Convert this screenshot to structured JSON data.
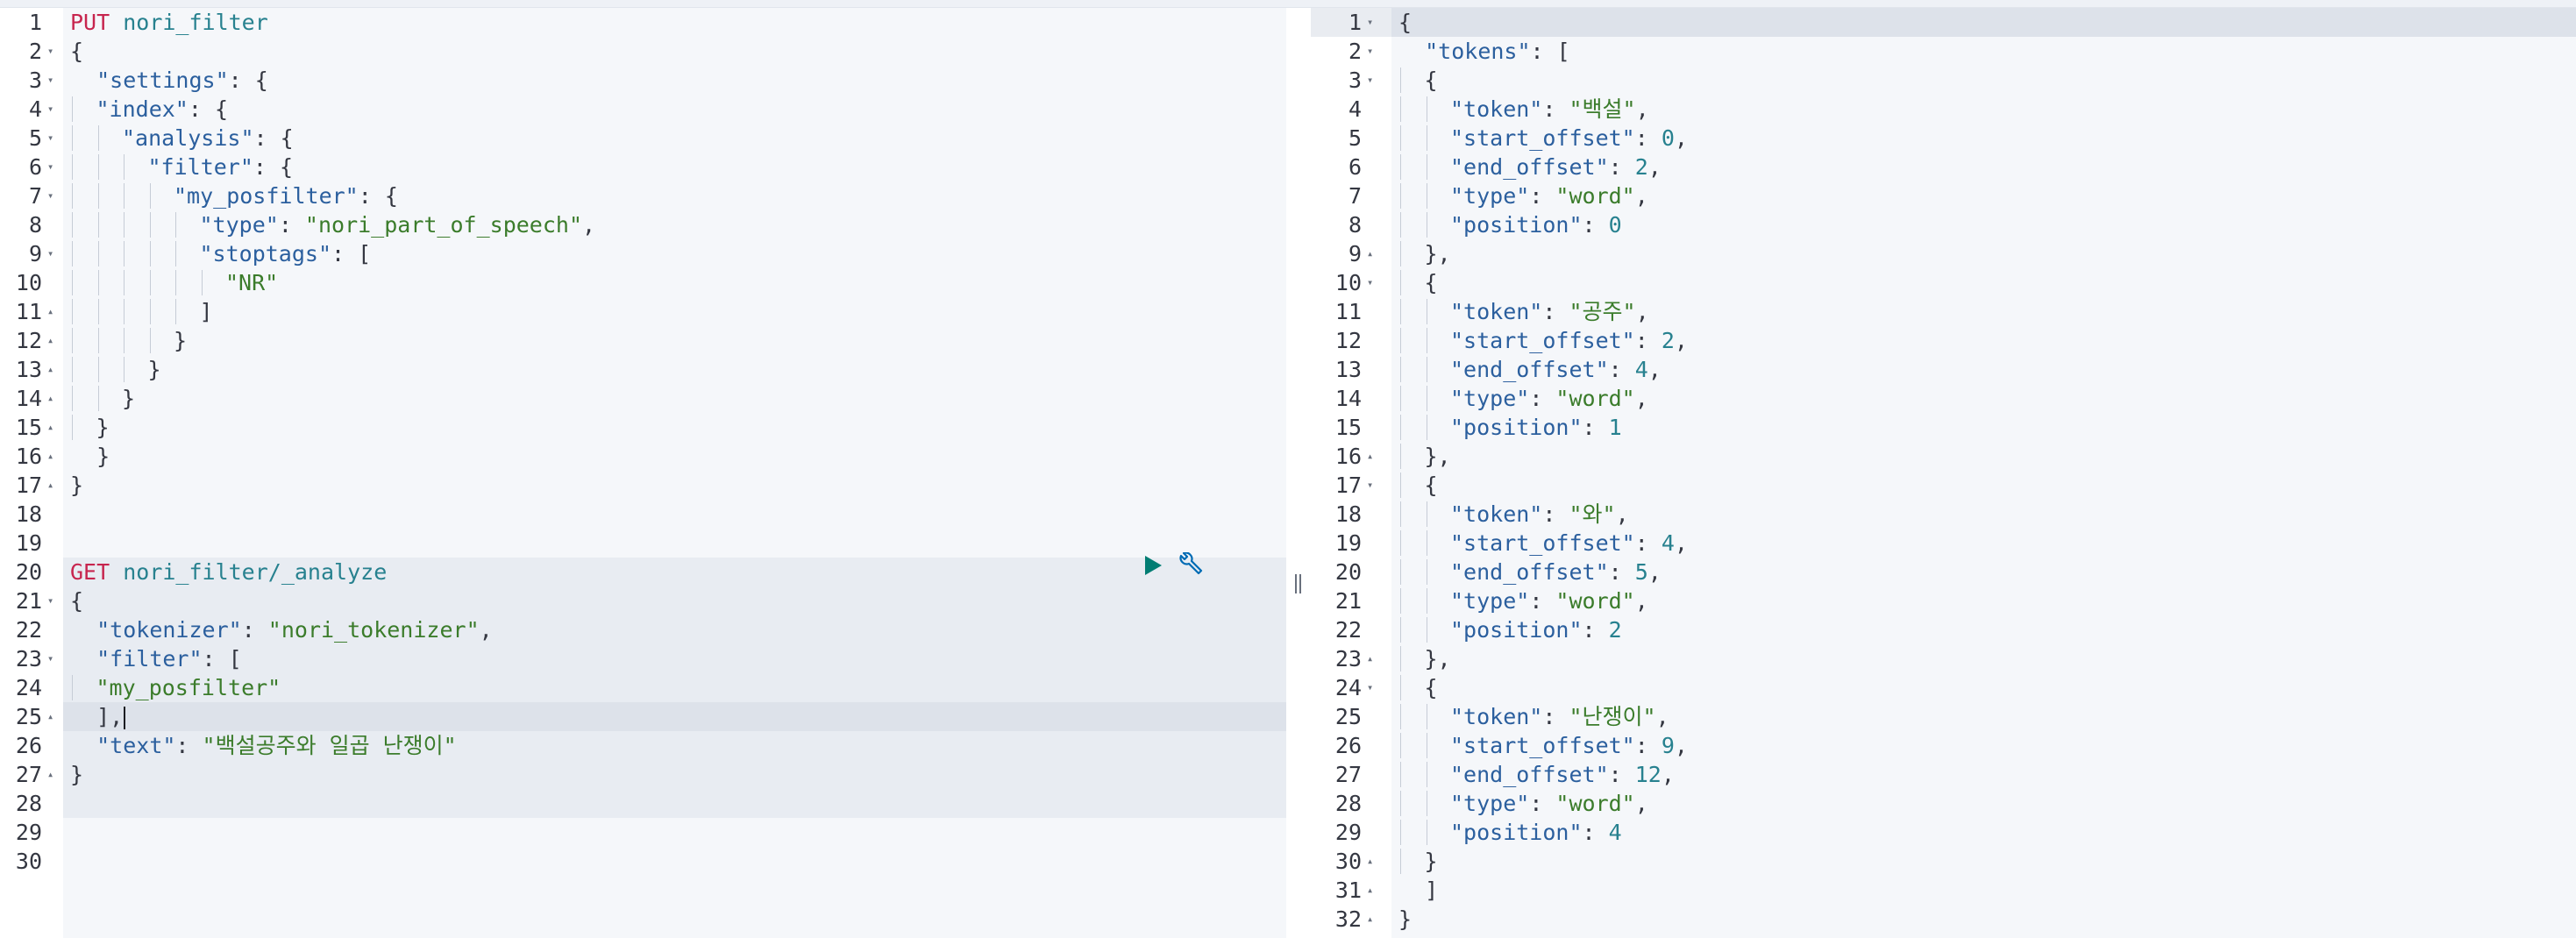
{
  "left_editor": {
    "run_button_label": "Run request",
    "settings_button_label": "Open documentation",
    "active_line": 25,
    "lines": [
      {
        "n": "1",
        "fold": "",
        "indent": 0,
        "tokens": [
          [
            "method",
            "PUT"
          ],
          [
            "punc",
            " "
          ],
          [
            "path",
            "nori_filter"
          ]
        ]
      },
      {
        "n": "2",
        "fold": "▾",
        "indent": 0,
        "tokens": [
          [
            "punc",
            "{"
          ]
        ]
      },
      {
        "n": "3",
        "fold": "▾",
        "indent": 0,
        "tokens": [
          [
            "punc",
            "  "
          ],
          [
            "key",
            "\"settings\""
          ],
          [
            "punc",
            ": {"
          ]
        ]
      },
      {
        "n": "4",
        "fold": "▾",
        "indent": 1,
        "tokens": [
          [
            "key",
            "\"index\""
          ],
          [
            "punc",
            ": {"
          ]
        ]
      },
      {
        "n": "5",
        "fold": "▾",
        "indent": 2,
        "tokens": [
          [
            "key",
            "\"analysis\""
          ],
          [
            "punc",
            ": {"
          ]
        ]
      },
      {
        "n": "6",
        "fold": "▾",
        "indent": 3,
        "tokens": [
          [
            "key",
            "\"filter\""
          ],
          [
            "punc",
            ": {"
          ]
        ]
      },
      {
        "n": "7",
        "fold": "▾",
        "indent": 4,
        "tokens": [
          [
            "key",
            "\"my_posfilter\""
          ],
          [
            "punc",
            ": {"
          ]
        ]
      },
      {
        "n": "8",
        "fold": "",
        "indent": 5,
        "tokens": [
          [
            "key",
            "\"type\""
          ],
          [
            "punc",
            ": "
          ],
          [
            "str",
            "\"nori_part_of_speech\""
          ],
          [
            "punc",
            ","
          ]
        ]
      },
      {
        "n": "9",
        "fold": "▾",
        "indent": 5,
        "tokens": [
          [
            "key",
            "\"stoptags\""
          ],
          [
            "punc",
            ": ["
          ]
        ]
      },
      {
        "n": "10",
        "fold": "",
        "indent": 6,
        "tokens": [
          [
            "str",
            "\"NR\""
          ]
        ]
      },
      {
        "n": "11",
        "fold": "▴",
        "indent": 5,
        "tokens": [
          [
            "punc",
            "]"
          ]
        ]
      },
      {
        "n": "12",
        "fold": "▴",
        "indent": 4,
        "tokens": [
          [
            "punc",
            "}"
          ]
        ]
      },
      {
        "n": "13",
        "fold": "▴",
        "indent": 3,
        "tokens": [
          [
            "punc",
            "}"
          ]
        ]
      },
      {
        "n": "14",
        "fold": "▴",
        "indent": 2,
        "tokens": [
          [
            "punc",
            "}"
          ]
        ]
      },
      {
        "n": "15",
        "fold": "▴",
        "indent": 1,
        "tokens": [
          [
            "punc",
            "}"
          ]
        ]
      },
      {
        "n": "16",
        "fold": "▴",
        "indent": 0,
        "tokens": [
          [
            "punc",
            "  }"
          ]
        ]
      },
      {
        "n": "17",
        "fold": "▴",
        "indent": 0,
        "tokens": [
          [
            "punc",
            "}"
          ]
        ]
      },
      {
        "n": "18",
        "fold": "",
        "indent": 0,
        "tokens": []
      },
      {
        "n": "19",
        "fold": "",
        "indent": 0,
        "tokens": []
      },
      {
        "n": "20",
        "fold": "",
        "indent": 0,
        "tokens": [
          [
            "method",
            "GET"
          ],
          [
            "punc",
            " "
          ],
          [
            "path",
            "nori_filter/_analyze"
          ]
        ]
      },
      {
        "n": "21",
        "fold": "▾",
        "indent": 0,
        "tokens": [
          [
            "punc",
            "{"
          ]
        ]
      },
      {
        "n": "22",
        "fold": "",
        "indent": 0,
        "tokens": [
          [
            "punc",
            "  "
          ],
          [
            "key",
            "\"tokenizer\""
          ],
          [
            "punc",
            ": "
          ],
          [
            "str",
            "\"nori_tokenizer\""
          ],
          [
            "punc",
            ","
          ]
        ]
      },
      {
        "n": "23",
        "fold": "▾",
        "indent": 0,
        "tokens": [
          [
            "punc",
            "  "
          ],
          [
            "key",
            "\"filter\""
          ],
          [
            "punc",
            ": ["
          ]
        ]
      },
      {
        "n": "24",
        "fold": "",
        "indent": 1,
        "tokens": [
          [
            "str",
            "\"my_posfilter\""
          ]
        ]
      },
      {
        "n": "25",
        "fold": "▴",
        "indent": 0,
        "tokens": [
          [
            "punc",
            "  ],"
          ]
        ]
      },
      {
        "n": "26",
        "fold": "",
        "indent": 0,
        "tokens": [
          [
            "punc",
            "  "
          ],
          [
            "key",
            "\"text\""
          ],
          [
            "punc",
            ": "
          ],
          [
            "str",
            "\"백설공주와 일곱 난쟁이\""
          ]
        ]
      },
      {
        "n": "27",
        "fold": "▴",
        "indent": 0,
        "tokens": [
          [
            "punc",
            "}"
          ]
        ]
      },
      {
        "n": "28",
        "fold": "",
        "indent": 0,
        "tokens": []
      },
      {
        "n": "29",
        "fold": "",
        "indent": 0,
        "tokens": []
      },
      {
        "n": "30",
        "fold": "",
        "indent": 0,
        "tokens": []
      }
    ]
  },
  "right_editor": {
    "lines": [
      {
        "n": "1",
        "fold": "▾",
        "indent": 0,
        "tokens": [
          [
            "punc",
            "{"
          ]
        ]
      },
      {
        "n": "2",
        "fold": "▾",
        "indent": 0,
        "tokens": [
          [
            "punc",
            "  "
          ],
          [
            "key",
            "\"tokens\""
          ],
          [
            "punc",
            ": ["
          ]
        ]
      },
      {
        "n": "3",
        "fold": "▾",
        "indent": 1,
        "tokens": [
          [
            "punc",
            "{"
          ]
        ]
      },
      {
        "n": "4",
        "fold": "",
        "indent": 2,
        "tokens": [
          [
            "key",
            "\"token\""
          ],
          [
            "punc",
            ": "
          ],
          [
            "str",
            "\"백설\""
          ],
          [
            "punc",
            ","
          ]
        ]
      },
      {
        "n": "5",
        "fold": "",
        "indent": 2,
        "tokens": [
          [
            "key",
            "\"start_offset\""
          ],
          [
            "punc",
            ": "
          ],
          [
            "num",
            "0"
          ],
          [
            "punc",
            ","
          ]
        ]
      },
      {
        "n": "6",
        "fold": "",
        "indent": 2,
        "tokens": [
          [
            "key",
            "\"end_offset\""
          ],
          [
            "punc",
            ": "
          ],
          [
            "num",
            "2"
          ],
          [
            "punc",
            ","
          ]
        ]
      },
      {
        "n": "7",
        "fold": "",
        "indent": 2,
        "tokens": [
          [
            "key",
            "\"type\""
          ],
          [
            "punc",
            ": "
          ],
          [
            "str",
            "\"word\""
          ],
          [
            "punc",
            ","
          ]
        ]
      },
      {
        "n": "8",
        "fold": "",
        "indent": 2,
        "tokens": [
          [
            "key",
            "\"position\""
          ],
          [
            "punc",
            ": "
          ],
          [
            "num",
            "0"
          ]
        ]
      },
      {
        "n": "9",
        "fold": "▴",
        "indent": 1,
        "tokens": [
          [
            "punc",
            "},"
          ]
        ]
      },
      {
        "n": "10",
        "fold": "▾",
        "indent": 1,
        "tokens": [
          [
            "punc",
            "{"
          ]
        ]
      },
      {
        "n": "11",
        "fold": "",
        "indent": 2,
        "tokens": [
          [
            "key",
            "\"token\""
          ],
          [
            "punc",
            ": "
          ],
          [
            "str",
            "\"공주\""
          ],
          [
            "punc",
            ","
          ]
        ]
      },
      {
        "n": "12",
        "fold": "",
        "indent": 2,
        "tokens": [
          [
            "key",
            "\"start_offset\""
          ],
          [
            "punc",
            ": "
          ],
          [
            "num",
            "2"
          ],
          [
            "punc",
            ","
          ]
        ]
      },
      {
        "n": "13",
        "fold": "",
        "indent": 2,
        "tokens": [
          [
            "key",
            "\"end_offset\""
          ],
          [
            "punc",
            ": "
          ],
          [
            "num",
            "4"
          ],
          [
            "punc",
            ","
          ]
        ]
      },
      {
        "n": "14",
        "fold": "",
        "indent": 2,
        "tokens": [
          [
            "key",
            "\"type\""
          ],
          [
            "punc",
            ": "
          ],
          [
            "str",
            "\"word\""
          ],
          [
            "punc",
            ","
          ]
        ]
      },
      {
        "n": "15",
        "fold": "",
        "indent": 2,
        "tokens": [
          [
            "key",
            "\"position\""
          ],
          [
            "punc",
            ": "
          ],
          [
            "num",
            "1"
          ]
        ]
      },
      {
        "n": "16",
        "fold": "▴",
        "indent": 1,
        "tokens": [
          [
            "punc",
            "},"
          ]
        ]
      },
      {
        "n": "17",
        "fold": "▾",
        "indent": 1,
        "tokens": [
          [
            "punc",
            "{"
          ]
        ]
      },
      {
        "n": "18",
        "fold": "",
        "indent": 2,
        "tokens": [
          [
            "key",
            "\"token\""
          ],
          [
            "punc",
            ": "
          ],
          [
            "str",
            "\"와\""
          ],
          [
            "punc",
            ","
          ]
        ]
      },
      {
        "n": "19",
        "fold": "",
        "indent": 2,
        "tokens": [
          [
            "key",
            "\"start_offset\""
          ],
          [
            "punc",
            ": "
          ],
          [
            "num",
            "4"
          ],
          [
            "punc",
            ","
          ]
        ]
      },
      {
        "n": "20",
        "fold": "",
        "indent": 2,
        "tokens": [
          [
            "key",
            "\"end_offset\""
          ],
          [
            "punc",
            ": "
          ],
          [
            "num",
            "5"
          ],
          [
            "punc",
            ","
          ]
        ]
      },
      {
        "n": "21",
        "fold": "",
        "indent": 2,
        "tokens": [
          [
            "key",
            "\"type\""
          ],
          [
            "punc",
            ": "
          ],
          [
            "str",
            "\"word\""
          ],
          [
            "punc",
            ","
          ]
        ]
      },
      {
        "n": "22",
        "fold": "",
        "indent": 2,
        "tokens": [
          [
            "key",
            "\"position\""
          ],
          [
            "punc",
            ": "
          ],
          [
            "num",
            "2"
          ]
        ]
      },
      {
        "n": "23",
        "fold": "▴",
        "indent": 1,
        "tokens": [
          [
            "punc",
            "},"
          ]
        ]
      },
      {
        "n": "24",
        "fold": "▾",
        "indent": 1,
        "tokens": [
          [
            "punc",
            "{"
          ]
        ]
      },
      {
        "n": "25",
        "fold": "",
        "indent": 2,
        "tokens": [
          [
            "key",
            "\"token\""
          ],
          [
            "punc",
            ": "
          ],
          [
            "str",
            "\"난쟁이\""
          ],
          [
            "punc",
            ","
          ]
        ]
      },
      {
        "n": "26",
        "fold": "",
        "indent": 2,
        "tokens": [
          [
            "key",
            "\"start_offset\""
          ],
          [
            "punc",
            ": "
          ],
          [
            "num",
            "9"
          ],
          [
            "punc",
            ","
          ]
        ]
      },
      {
        "n": "27",
        "fold": "",
        "indent": 2,
        "tokens": [
          [
            "key",
            "\"end_offset\""
          ],
          [
            "punc",
            ": "
          ],
          [
            "num",
            "12"
          ],
          [
            "punc",
            ","
          ]
        ]
      },
      {
        "n": "28",
        "fold": "",
        "indent": 2,
        "tokens": [
          [
            "key",
            "\"type\""
          ],
          [
            "punc",
            ": "
          ],
          [
            "str",
            "\"word\""
          ],
          [
            "punc",
            ","
          ]
        ]
      },
      {
        "n": "29",
        "fold": "",
        "indent": 2,
        "tokens": [
          [
            "key",
            "\"position\""
          ],
          [
            "punc",
            ": "
          ],
          [
            "num",
            "4"
          ]
        ]
      },
      {
        "n": "30",
        "fold": "▴",
        "indent": 1,
        "tokens": [
          [
            "punc",
            "}"
          ]
        ]
      },
      {
        "n": "31",
        "fold": "▴",
        "indent": 0,
        "tokens": [
          [
            "punc",
            "  ]"
          ]
        ]
      },
      {
        "n": "32",
        "fold": "▴",
        "indent": 0,
        "tokens": [
          [
            "punc",
            "}"
          ]
        ]
      }
    ]
  },
  "colors": {
    "method": "#c7254e",
    "path": "#27818f",
    "key": "#2b5f9e",
    "string": "#3b7c2b",
    "number": "#27818f",
    "run_icon": "#017d73",
    "wrench_icon": "#006bb4"
  },
  "icons": {
    "run": "play-icon",
    "settings": "wrench-icon",
    "splitter": "resize-handle-icon"
  }
}
